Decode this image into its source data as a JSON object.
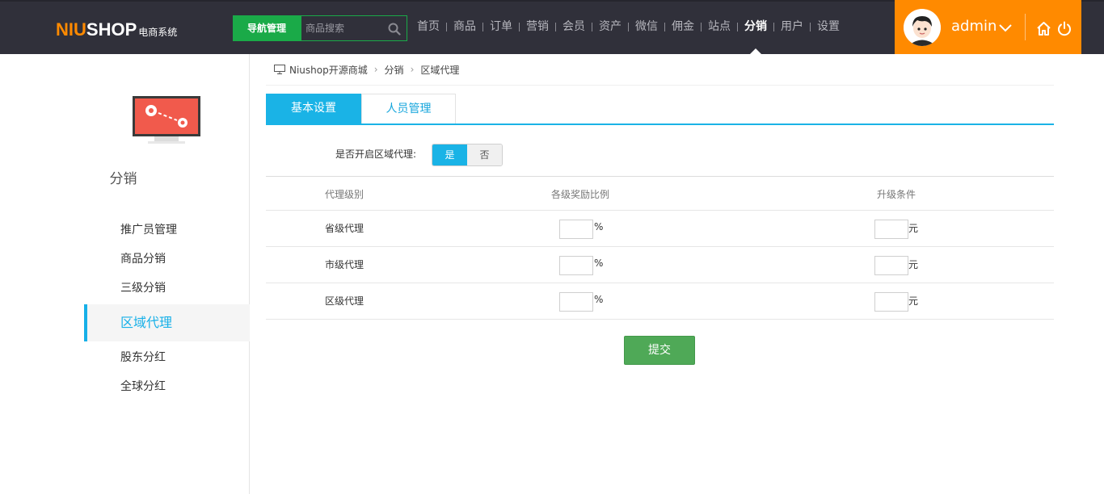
{
  "logo": {
    "brand_a": "NIU",
    "brand_b": "SHOP",
    "subtitle": "电商系统"
  },
  "header": {
    "nav_manager_label": "导航管理",
    "search_placeholder": "商品搜索",
    "nav": [
      "首页",
      "商品",
      "订单",
      "营销",
      "会员",
      "资产",
      "微信",
      "佣金",
      "站点",
      "分销",
      "用户",
      "设置"
    ],
    "active_nav": "分销",
    "username": "admin",
    "accent_color": "#ff8a00"
  },
  "sidebar": {
    "module_title": "分销",
    "items": [
      {
        "label": "推广员管理"
      },
      {
        "label": "商品分销"
      },
      {
        "label": "三级分销"
      },
      {
        "label": "区域代理",
        "active": true
      },
      {
        "label": "股东分红"
      },
      {
        "label": "全球分红"
      }
    ]
  },
  "breadcrumb": [
    "Niushop开源商城",
    "分销",
    "区域代理"
  ],
  "tabs": [
    {
      "label": "基本设置",
      "active": true
    },
    {
      "label": "人员管理"
    }
  ],
  "setting": {
    "label": "是否开启区域代理:",
    "yes": "是",
    "no": "否",
    "selected": "是"
  },
  "table": {
    "headers": [
      "代理级别",
      "各级奖励比例",
      "升级条件"
    ],
    "rows": [
      {
        "level": "省级代理",
        "ratio": "",
        "ratio_unit": "%",
        "condition": "",
        "condition_unit": "元"
      },
      {
        "level": "市级代理",
        "ratio": "",
        "ratio_unit": "%",
        "condition": "",
        "condition_unit": "元"
      },
      {
        "level": "区级代理",
        "ratio": "",
        "ratio_unit": "%",
        "condition": "",
        "condition_unit": "元"
      }
    ]
  },
  "submit_label": "提交"
}
